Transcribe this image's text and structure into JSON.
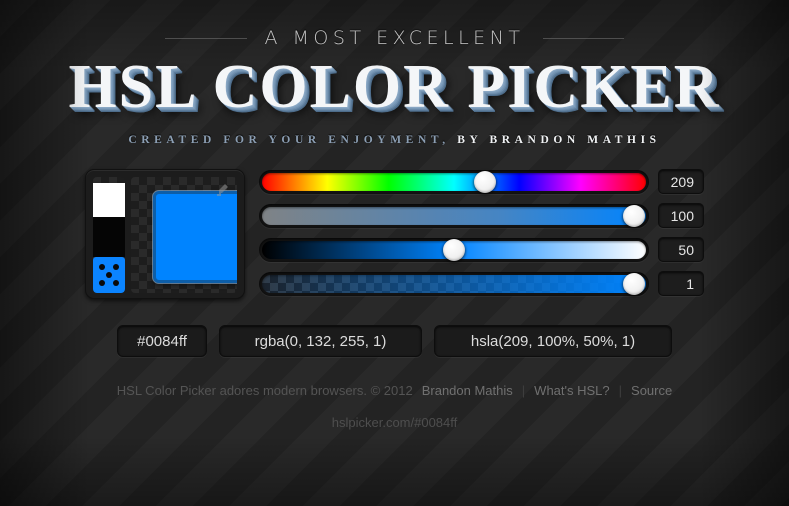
{
  "header": {
    "eyebrow": "A MOST EXCELLENT",
    "title": "HSL COLOR PICKER",
    "byline_dim": "CREATED FOR YOUR ENJOYMENT,",
    "byline_bright": "BY BRANDON MATHIS"
  },
  "picker": {
    "preview_color": "#0084ff",
    "white_swatch": "#ffffff",
    "black_swatch": "#000000",
    "random_icon": "dice-five-icon",
    "eyedropper_icon": "eyedropper-icon"
  },
  "sliders": [
    {
      "name": "hue",
      "value": "209",
      "percent": 58.1,
      "track_type": "hue-rainbow"
    },
    {
      "name": "saturation",
      "value": "100",
      "percent": 97.0,
      "track_type": "gray-to-color"
    },
    {
      "name": "lightness",
      "value": "50",
      "percent": 50.0,
      "track_type": "black-to-color-to-white"
    },
    {
      "name": "alpha",
      "value": "1",
      "percent": 97.0,
      "track_type": "transparent-to-color"
    }
  ],
  "outputs": {
    "hex": "#0084ff",
    "rgba": "rgba(0, 132, 255, 1)",
    "hsla": "hsla(209, 100%, 50%, 1)"
  },
  "footer": {
    "credit": "HSL Color Picker adores modern browsers. © 2012",
    "author_link": "Brandon Mathis",
    "sep": "|",
    "whats_hsl_link": "What's HSL?",
    "source_link": "Source",
    "url": "hslpicker.com/#0084ff"
  },
  "colors": {
    "accent": "#0084ff",
    "background": "#262626",
    "title_shadow": "#5d7d9c"
  }
}
